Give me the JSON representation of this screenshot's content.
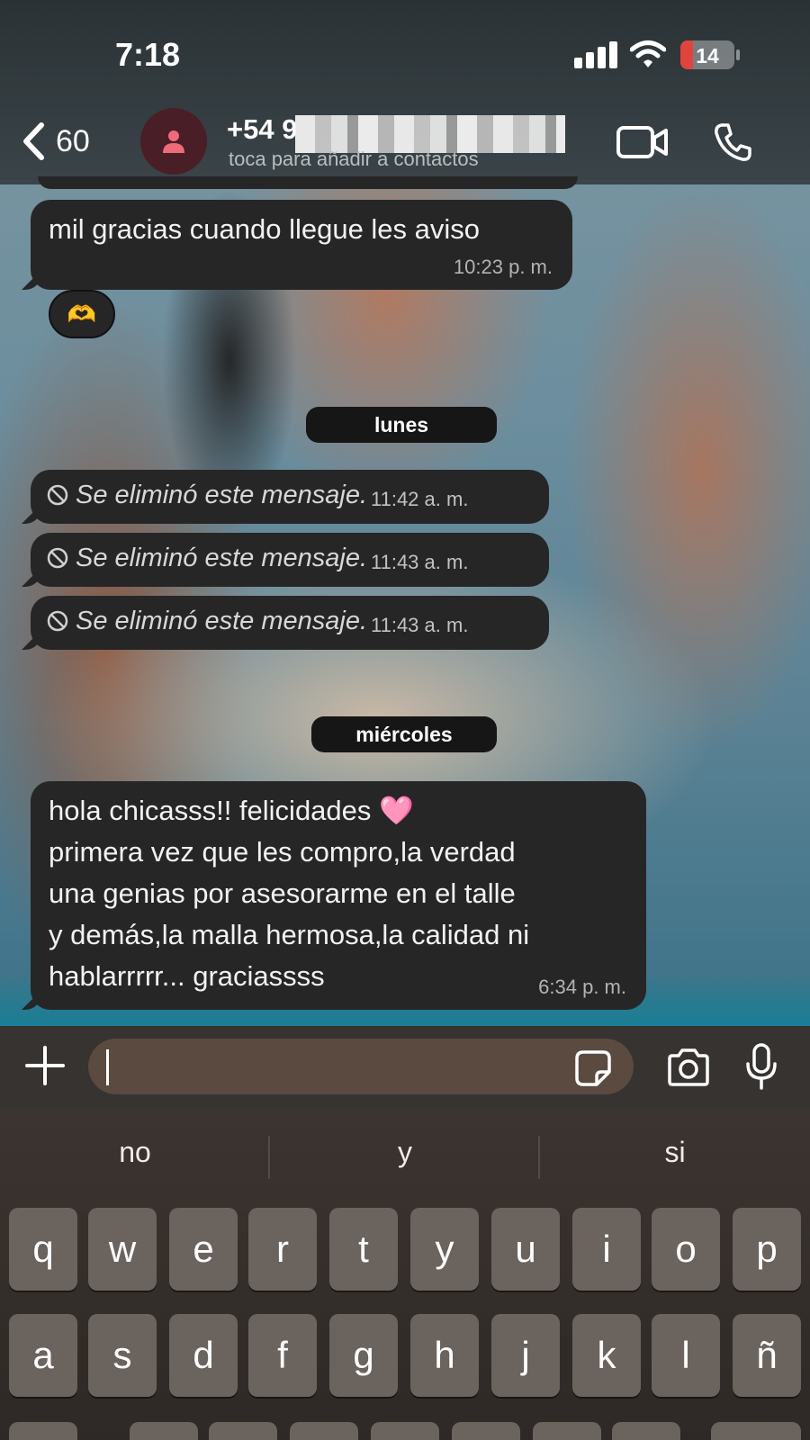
{
  "status_bar": {
    "time": "7:18",
    "battery": "14",
    "battery_color": "#e0453d"
  },
  "header": {
    "back_count": "60",
    "contact_name": "+54 9",
    "contact_subtitle": "toca para añadir a contactos",
    "avatar_color": "#4a1e26",
    "icons": [
      "chevron-left-icon",
      "person-icon",
      "video-call-icon",
      "phone-icon"
    ]
  },
  "messages": {
    "first": {
      "text": "mil gracias cuando llegue les aviso",
      "time": "10:23 p. m.",
      "reaction": "🫶"
    },
    "day1": "lunes",
    "deleted": [
      {
        "text": "Se eliminó este mensaje.",
        "time": "11:42 a. m."
      },
      {
        "text": "Se eliminó este mensaje.",
        "time": "11:43 a. m."
      },
      {
        "text": "Se eliminó este mensaje.",
        "time": "11:43 a. m."
      }
    ],
    "day2": "miércoles",
    "last": {
      "lines": [
        "hola chicasss!! felicidades 🩷",
        "primera vez que les compro,la verdad",
        "una genias por asesorarme en el talle",
        "y demás,la malla hermosa,la calidad ni",
        "hablarrrrr... graciassss"
      ],
      "time": "6:34 p. m."
    }
  },
  "composer": {
    "placeholder": "",
    "icons": [
      "plus-icon",
      "sticker-icon",
      "camera-icon",
      "microphone-icon"
    ]
  },
  "keyboard": {
    "suggestions": [
      "no",
      "y",
      "si"
    ],
    "row1": [
      "q",
      "w",
      "e",
      "r",
      "t",
      "y",
      "u",
      "i",
      "o",
      "p"
    ],
    "row2": [
      "a",
      "s",
      "d",
      "f",
      "g",
      "h",
      "j",
      "k",
      "l",
      "ñ"
    ]
  }
}
